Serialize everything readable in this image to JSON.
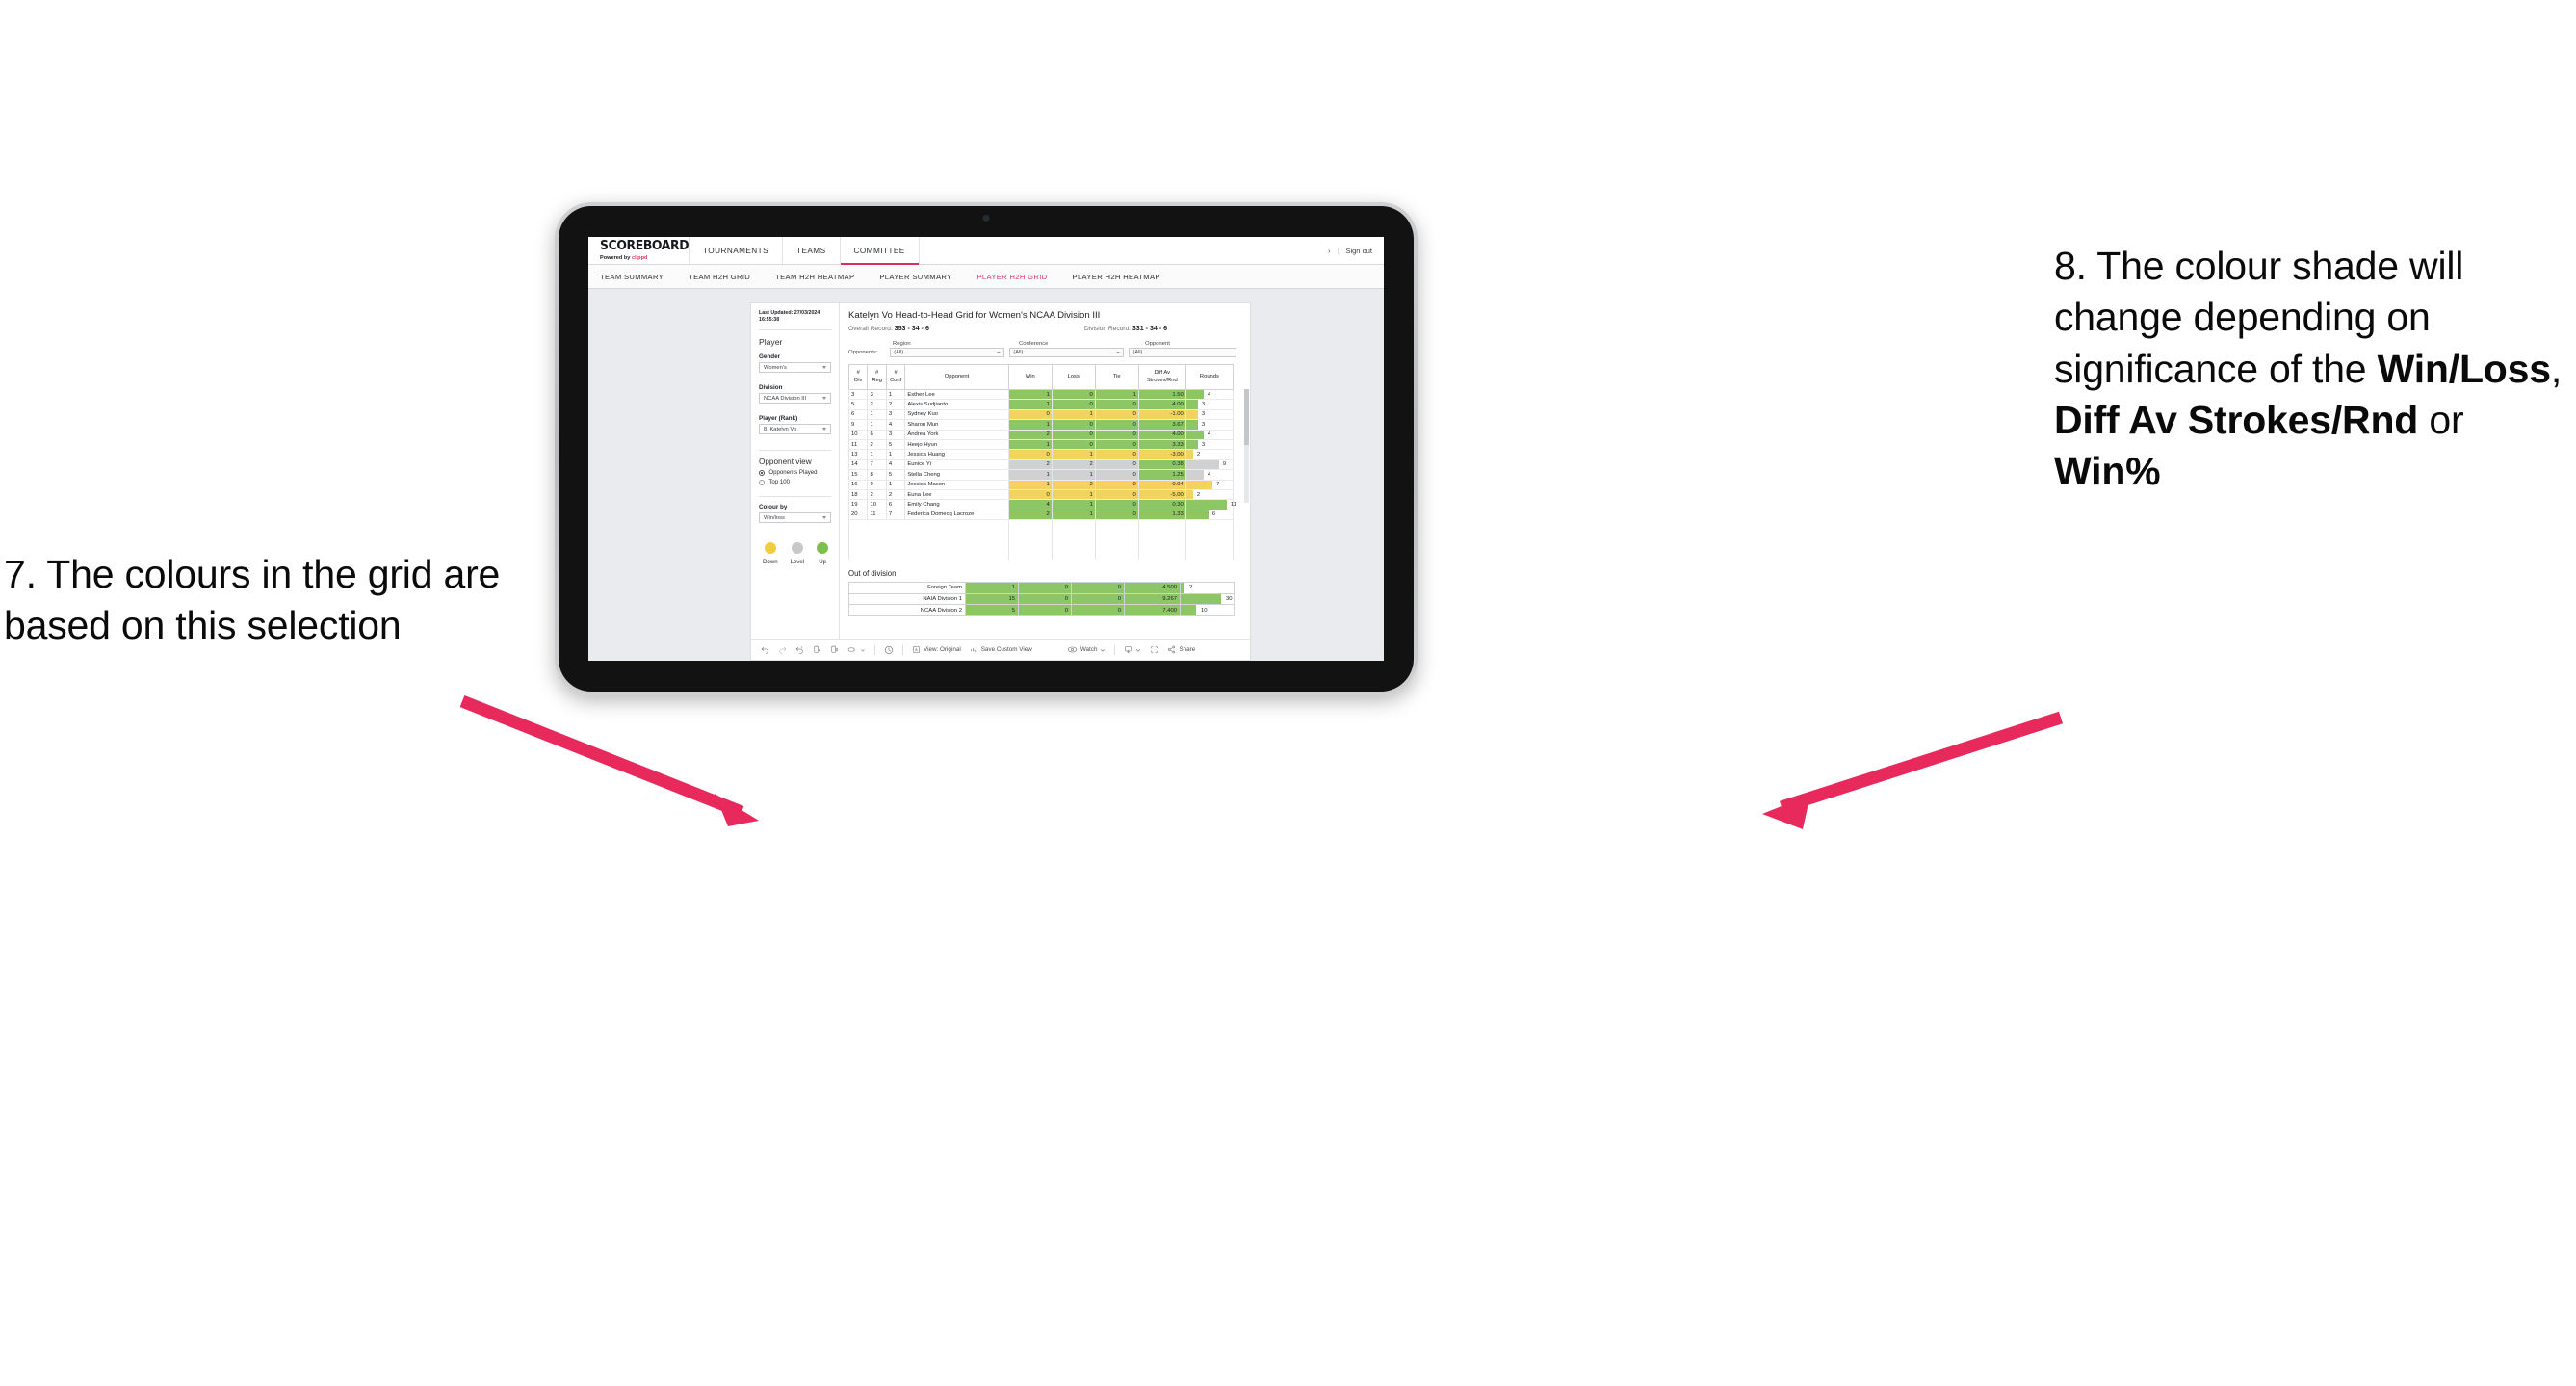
{
  "annotations": {
    "left": "7. The colours in the grid are based on this selection",
    "right_plain_1": "8. The colour shade will change depending on significance of the ",
    "right_bold_1": "Win/Loss",
    "right_sep_1": ", ",
    "right_bold_2": "Diff Av Strokes/Rnd",
    "right_plain_2": " or ",
    "right_bold_3": "Win%",
    "arrow_color": "#e8295c"
  },
  "app": {
    "brand": {
      "title": "SCOREBOARD",
      "powered_prefix": "Powered by ",
      "powered_brand": "clippd"
    },
    "topnav": [
      {
        "label": "TOURNAMENTS",
        "active": false
      },
      {
        "label": "TEAMS",
        "active": false
      },
      {
        "label": "COMMITTEE",
        "active": true
      }
    ],
    "topright": {
      "chevron": "›",
      "divider": "|",
      "signout": "Sign out"
    },
    "subnav": [
      {
        "label": "TEAM SUMMARY",
        "active": false
      },
      {
        "label": "TEAM H2H GRID",
        "active": false
      },
      {
        "label": "TEAM H2H HEATMAP",
        "active": false
      },
      {
        "label": "PLAYER SUMMARY",
        "active": false
      },
      {
        "label": "PLAYER H2H GRID",
        "active": true
      },
      {
        "label": "PLAYER H2H HEATMAP",
        "active": false
      }
    ],
    "accent": "#d8305c"
  },
  "sidebar": {
    "last_updated": "Last Updated: 27/03/2024 16:55:38",
    "player_heading": "Player",
    "gender": {
      "label": "Gender",
      "value": "Women's"
    },
    "division": {
      "label": "Division",
      "value": "NCAA Division III"
    },
    "player_rank": {
      "label": "Player (Rank)",
      "value": "8. Katelyn Vo"
    },
    "opponent_view": {
      "heading": "Opponent view",
      "options": [
        {
          "label": "Opponents Played",
          "selected": true
        },
        {
          "label": "Top 100",
          "selected": false
        }
      ]
    },
    "colour_by": {
      "label": "Colour by",
      "value": "Win/loss"
    },
    "legend": [
      {
        "label": "Down",
        "color": "#f0cd3e"
      },
      {
        "label": "Level",
        "color": "#c6c8ca"
      },
      {
        "label": "Up",
        "color": "#7dc14b"
      }
    ]
  },
  "viz": {
    "title": "Katelyn Vo Head-to-Head Grid for Women's NCAA Division III",
    "overall_record_label": "Overall Record: ",
    "overall_record_value": "353 -  34 - 6",
    "division_record_label": "Division Record: ",
    "division_record_value": "331 -  34 - 6",
    "opponents_tag": "Opponents:",
    "filters": [
      {
        "label": "Region",
        "value": "(All)"
      },
      {
        "label": "Conference",
        "value": "(All)"
      },
      {
        "label": "Opponent",
        "value": "(All)"
      }
    ],
    "columns": [
      {
        "l1": "#",
        "l2": "Div"
      },
      {
        "l1": "#",
        "l2": "Reg"
      },
      {
        "l1": "#",
        "l2": "Conf"
      },
      {
        "l1": "Opponent",
        "l2": ""
      },
      {
        "l1": "Win",
        "l2": ""
      },
      {
        "l1": "Loss",
        "l2": ""
      },
      {
        "l1": "Tie",
        "l2": ""
      },
      {
        "l1": "Diff Av",
        "l2": "Strokes/Rnd"
      },
      {
        "l1": "Rounds",
        "l2": ""
      }
    ],
    "rows": [
      {
        "div": "3",
        "reg": "3",
        "conf": "1",
        "opponent": "Esther Lee",
        "win": "1",
        "loss": "0",
        "tie": "1",
        "diff": "1.50",
        "rounds": "4",
        "color": "#8dc765",
        "rounds_w": 18
      },
      {
        "div": "5",
        "reg": "2",
        "conf": "2",
        "opponent": "Alexis Sudjianto",
        "win": "1",
        "loss": "0",
        "tie": "0",
        "diff": "4.00",
        "rounds": "3",
        "color": "#8dc765",
        "rounds_w": 12
      },
      {
        "div": "6",
        "reg": "1",
        "conf": "3",
        "opponent": "Sydney Kuo",
        "win": "0",
        "loss": "1",
        "tie": "0",
        "diff": "-1.00",
        "rounds": "3",
        "color": "#f3d35e",
        "rounds_w": 12
      },
      {
        "div": "9",
        "reg": "1",
        "conf": "4",
        "opponent": "Sharon Mun",
        "win": "1",
        "loss": "0",
        "tie": "0",
        "diff": "3.67",
        "rounds": "3",
        "color": "#8dc765",
        "rounds_w": 12
      },
      {
        "div": "10",
        "reg": "6",
        "conf": "3",
        "opponent": "Andrea York",
        "win": "2",
        "loss": "0",
        "tie": "0",
        "diff": "4.00",
        "rounds": "4",
        "color": "#8dc765",
        "rounds_w": 18
      },
      {
        "div": "11",
        "reg": "2",
        "conf": "5",
        "opponent": "Heejo Hyun",
        "win": "1",
        "loss": "0",
        "tie": "0",
        "diff": "3.33",
        "rounds": "3",
        "color": "#8dc765",
        "rounds_w": 12
      },
      {
        "div": "13",
        "reg": "1",
        "conf": "1",
        "opponent": "Jessica Huang",
        "win": "0",
        "loss": "1",
        "tie": "0",
        "diff": "-3.00",
        "rounds": "2",
        "color": "#f3d35e",
        "rounds_w": 7
      },
      {
        "div": "14",
        "reg": "7",
        "conf": "4",
        "opponent": "Eunice Yi",
        "win": "2",
        "loss": "2",
        "tie": "0",
        "diff": "0.38",
        "rounds": "9",
        "color": "#cfd1d3",
        "rounds_w": 34,
        "diff_color": "#8dc765"
      },
      {
        "div": "15",
        "reg": "8",
        "conf": "5",
        "opponent": "Stella Cheng",
        "win": "1",
        "loss": "1",
        "tie": "0",
        "diff": "1.25",
        "rounds": "4",
        "color": "#cfd1d3",
        "rounds_w": 18,
        "diff_color": "#8dc765"
      },
      {
        "div": "16",
        "reg": "9",
        "conf": "1",
        "opponent": "Jessica Mason",
        "win": "1",
        "loss": "2",
        "tie": "0",
        "diff": "-0.94",
        "rounds": "7",
        "color": "#f3d35e",
        "rounds_w": 27
      },
      {
        "div": "18",
        "reg": "2",
        "conf": "2",
        "opponent": "Euna Lee",
        "win": "0",
        "loss": "1",
        "tie": "0",
        "diff": "-5.00",
        "rounds": "2",
        "color": "#f3d35e",
        "rounds_w": 7
      },
      {
        "div": "19",
        "reg": "10",
        "conf": "6",
        "opponent": "Emily Chang",
        "win": "4",
        "loss": "1",
        "tie": "0",
        "diff": "0.30",
        "rounds": "11",
        "color": "#8dc765",
        "rounds_w": 42
      },
      {
        "div": "20",
        "reg": "11",
        "conf": "7",
        "opponent": "Federica Domecq Lacroze",
        "win": "2",
        "loss": "1",
        "tie": "0",
        "diff": "1.33",
        "rounds": "6",
        "color": "#8dc765",
        "rounds_w": 23
      }
    ],
    "out_of_division": {
      "heading": "Out of division",
      "rows": [
        {
          "name": "Foreign Team",
          "win": "1",
          "loss": "0",
          "tie": "0",
          "diff": "4.500",
          "rounds": "2",
          "color": "#8dc765",
          "rounds_w": 4
        },
        {
          "name": "NAIA Division 1",
          "win": "15",
          "loss": "0",
          "tie": "0",
          "diff": "9.267",
          "rounds": "30",
          "color": "#8dc765",
          "rounds_w": 42
        },
        {
          "name": "NCAA Division 2",
          "win": "5",
          "loss": "0",
          "tie": "0",
          "diff": "7.400",
          "rounds": "10",
          "color": "#8dc765",
          "rounds_w": 16
        }
      ]
    }
  },
  "toolbar": {
    "view_label": "View: Original",
    "save_label": "Save Custom View",
    "watch_label": "Watch",
    "share_label": "Share"
  }
}
